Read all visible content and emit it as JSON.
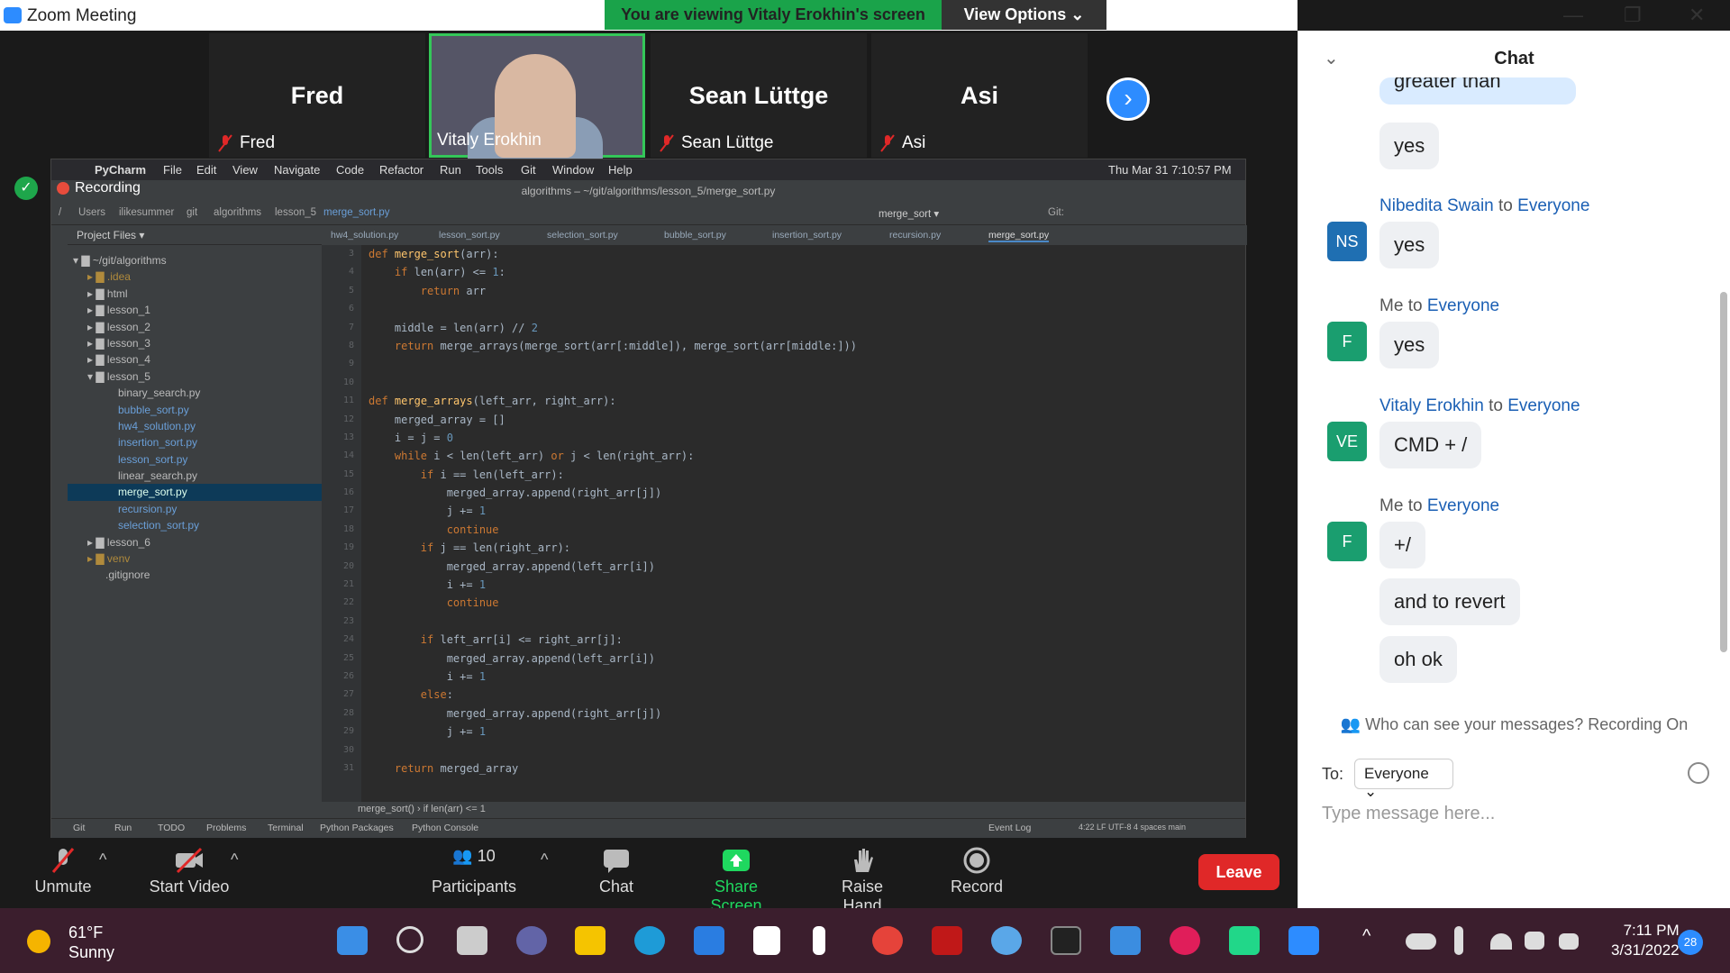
{
  "window": {
    "title": "Zoom Meeting",
    "minimize": "—",
    "restore": "❐",
    "close": "✕"
  },
  "banner": {
    "viewing": "You are viewing Vitaly Erokhin's screen",
    "view_options": "View Options ⌄"
  },
  "participants_strip": [
    {
      "big_name": "Fred",
      "label": "Fred",
      "muted": true
    },
    {
      "big_name": "",
      "label": "Vitaly Erokhin",
      "muted": false,
      "video": true
    },
    {
      "big_name": "Sean Lüttge",
      "label": "Sean Lüttge",
      "muted": true
    },
    {
      "big_name": "Asi",
      "label": "Asi",
      "muted": true
    }
  ],
  "shared_screen": {
    "recording": "Recording",
    "mac_menu": [
      "PyCharm",
      "File",
      "Edit",
      "View",
      "Navigate",
      "Code",
      "Refactor",
      "Run",
      "Tools",
      "Git",
      "Window",
      "Help"
    ],
    "mac_clock": "Thu Mar 31  7:10:57 PM",
    "pycharm_title": "algorithms – ~/git/algorithms/lesson_5/merge_sort.py",
    "breadcrumb": [
      "/",
      "Users",
      "ilikesummer",
      "git",
      "algorithms",
      "lesson_5",
      "merge_sort.py"
    ],
    "run_config": "merge_sort ▾",
    "git_label": "Git:",
    "project_header": "Project Files ▾",
    "tree": [
      {
        "label": "▾ ▇ ~/git/algorithms",
        "indent": 0
      },
      {
        "label": "▸ ▇ .idea",
        "indent": 1
      },
      {
        "label": "▸ ▇ html",
        "indent": 1
      },
      {
        "label": "▸ ▇ lesson_1",
        "indent": 1
      },
      {
        "label": "▸ ▇ lesson_2",
        "indent": 1
      },
      {
        "label": "▸ ▇ lesson_3",
        "indent": 1
      },
      {
        "label": "▸ ▇ lesson_4",
        "indent": 1
      },
      {
        "label": "▾ ▇ lesson_5",
        "indent": 1
      },
      {
        "label": "binary_search.py",
        "indent": 2
      },
      {
        "label": "bubble_sort.py",
        "indent": 2
      },
      {
        "label": "hw4_solution.py",
        "indent": 2
      },
      {
        "label": "insertion_sort.py",
        "indent": 2
      },
      {
        "label": "lesson_sort.py",
        "indent": 2
      },
      {
        "label": "linear_search.py",
        "indent": 2
      },
      {
        "label": "merge_sort.py",
        "indent": 2,
        "selected": true
      },
      {
        "label": "recursion.py",
        "indent": 2
      },
      {
        "label": "selection_sort.py",
        "indent": 2
      },
      {
        "label": "▸ ▇ lesson_6",
        "indent": 1
      },
      {
        "label": "▸ ▇ venv",
        "indent": 1
      },
      {
        "label": ".gitignore",
        "indent": 1
      }
    ],
    "tabs": [
      "hw4_solution.py",
      "lesson_sort.py",
      "selection_sort.py",
      "bubble_sort.py",
      "insertion_sort.py",
      "recursion.py",
      "merge_sort.py"
    ],
    "line_numbers": [
      "3",
      "4",
      "5",
      "6",
      "7",
      "8",
      "9",
      "10",
      "11",
      "12",
      "13",
      "14",
      "15",
      "16",
      "17",
      "18",
      "19",
      "20",
      "21",
      "22",
      "23",
      "24",
      "25",
      "26",
      "27",
      "28",
      "29",
      "30",
      "31"
    ],
    "code_lines": [
      "def merge_sort(arr):",
      "    if len(arr) <= 1:",
      "        return arr",
      "",
      "    middle = len(arr) // 2",
      "    return merge_arrays(merge_sort(arr[:middle]), merge_sort(arr[middle:]))",
      "",
      "",
      "def merge_arrays(left_arr, right_arr):",
      "    merged_array = []",
      "    i = j = 0",
      "    while i < len(left_arr) or j < len(right_arr):",
      "        if i == len(left_arr):",
      "            merged_array.append(right_arr[j])",
      "            j += 1",
      "            continue",
      "        if j == len(right_arr):",
      "            merged_array.append(left_arr[i])",
      "            i += 1",
      "            continue",
      "",
      "        if left_arr[i] <= right_arr[j]:",
      "            merged_array.append(left_arr[i])",
      "            i += 1",
      "        else:",
      "            merged_array.append(right_arr[j])",
      "            j += 1",
      "",
      "    return merged_array"
    ],
    "status_crumb": "merge_sort()   ›   if len(arr) <= 1",
    "bottom_tools": [
      "Git",
      "Run",
      "TODO",
      "Problems",
      "Terminal",
      "Python Packages",
      "Python Console"
    ],
    "event_log": "Event Log",
    "cursor_info": "4:22   LF   UTF-8   4 spaces   main"
  },
  "chat": {
    "title": "Chat",
    "messages": [
      {
        "text": "greater than",
        "kind": "partial"
      },
      {
        "text": "yes"
      },
      {
        "sender": "Nibedita Swain",
        "to": "to",
        "target": "Everyone",
        "initials": "NS",
        "color": "#1f6fb2",
        "text": "yes"
      },
      {
        "sender": "Me",
        "to": "to",
        "target": "Everyone",
        "initials": "F",
        "color": "#1a9e6f",
        "text": "yes"
      },
      {
        "sender": "Vitaly Erokhin",
        "to": "to",
        "target": "Everyone",
        "initials": "VE",
        "color": "#1a9e6f",
        "text": "CMD + /"
      },
      {
        "sender": "Me",
        "to": "to",
        "target": "Everyone",
        "initials": "F",
        "color": "#1a9e6f",
        "text": "+/"
      },
      {
        "text": "and to revert"
      },
      {
        "text": "oh ok"
      }
    ],
    "notice": "Who can see your messages? Recording On",
    "to_label": "To:",
    "to_value": "Everyone ⌄",
    "placeholder": "Type message here..."
  },
  "controls": {
    "unmute": "Unmute",
    "start_video": "Start Video",
    "participants": "Participants",
    "participants_count": "10",
    "chat": "Chat",
    "share_screen": "Share Screen",
    "raise_hand": "Raise Hand",
    "record": "Record",
    "leave": "Leave"
  },
  "taskbar": {
    "temp": "61°F",
    "condition": "Sunny",
    "time": "7:11 PM",
    "date": "3/31/2022",
    "notifications": "28",
    "icons": [
      "windows-start-icon",
      "search-icon",
      "task-view-icon",
      "teams-chat-icon",
      "file-explorer-icon",
      "edge-icon",
      "mail-icon",
      "dropbox-icon",
      "arrow-app-icon",
      "chrome-icon",
      "mcafee-icon",
      "paint-icon",
      "terminal-icon",
      "notepad-icon",
      "slack-icon",
      "pycharm-icon",
      "zoom-icon"
    ]
  }
}
